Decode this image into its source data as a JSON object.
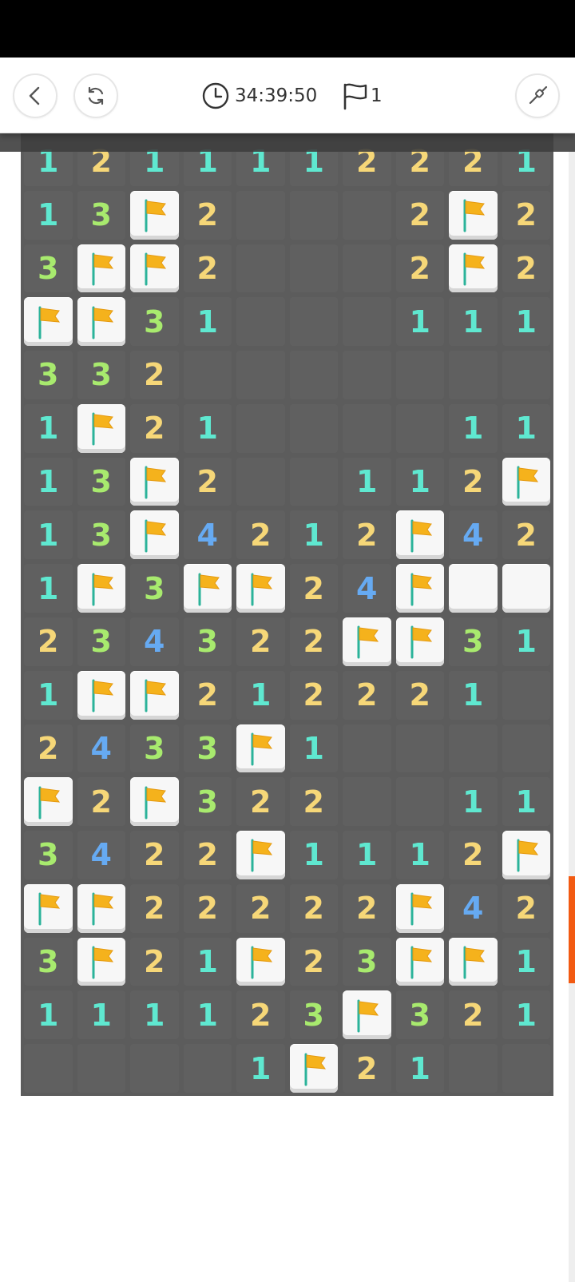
{
  "toolbar": {
    "timer": "34:39:50",
    "flag_count": "1",
    "icons": [
      "back-icon",
      "restart-icon",
      "clock-icon",
      "flag-icon",
      "shovel-icon"
    ]
  },
  "colors": {
    "n1": "#5fe8d0",
    "n2": "#f6d778",
    "n3": "#a8ea6e",
    "n4": "#66aaf2",
    "board": "#5c5c5c",
    "flag": "#f5b21c",
    "scroll_thumb": "#f25a12"
  },
  "board": {
    "cols": 10,
    "rows": [
      [
        "1",
        "2",
        "1",
        "1",
        "1",
        "1",
        "2",
        "2",
        "2",
        "1"
      ],
      [
        "1",
        "3",
        "F",
        "2",
        "",
        "",
        "",
        "2",
        "F",
        "2"
      ],
      [
        "3",
        "F",
        "F",
        "2",
        "",
        "",
        "",
        "2",
        "F",
        "2"
      ],
      [
        "F",
        "F",
        "3",
        "1",
        "",
        "",
        "",
        "1",
        "1",
        "1"
      ],
      [
        "3",
        "3",
        "2",
        "",
        "",
        "",
        "",
        "",
        "",
        ""
      ],
      [
        "1",
        "F",
        "2",
        "1",
        "",
        "",
        "",
        "",
        "1",
        "1"
      ],
      [
        "1",
        "3",
        "F",
        "2",
        "",
        "",
        "1",
        "1",
        "2",
        "F"
      ],
      [
        "1",
        "3",
        "F",
        "4",
        "2",
        "1",
        "2",
        "F",
        "4",
        "2"
      ],
      [
        "1",
        "F",
        "3",
        "F",
        "F",
        "2",
        "4",
        "F",
        "C",
        "C"
      ],
      [
        "2",
        "3",
        "4",
        "3",
        "2",
        "2",
        "F",
        "F",
        "3",
        "1"
      ],
      [
        "1",
        "F",
        "F",
        "2",
        "1",
        "2",
        "2",
        "2",
        "1",
        ""
      ],
      [
        "2",
        "4",
        "3",
        "3",
        "F",
        "1",
        "",
        "",
        "",
        ""
      ],
      [
        "F",
        "2",
        "F",
        "3",
        "2",
        "2",
        "",
        "",
        "1",
        "1"
      ],
      [
        "3",
        "4",
        "2",
        "2",
        "F",
        "1",
        "1",
        "1",
        "2",
        "F"
      ],
      [
        "F",
        "F",
        "2",
        "2",
        "2",
        "2",
        "2",
        "F",
        "4",
        "2"
      ],
      [
        "3",
        "F",
        "2",
        "1",
        "F",
        "2",
        "3",
        "F",
        "F",
        "1"
      ],
      [
        "1",
        "1",
        "1",
        "1",
        "2",
        "3",
        "F",
        "3",
        "2",
        "1"
      ],
      [
        "",
        "",
        "",
        "",
        "1",
        "F",
        "2",
        "1",
        "",
        ""
      ]
    ]
  }
}
